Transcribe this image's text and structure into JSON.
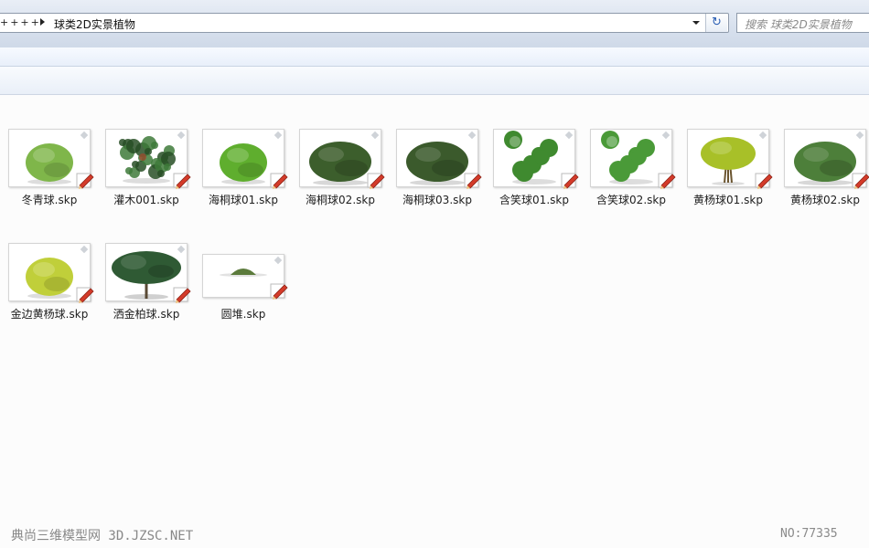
{
  "address": {
    "prev_segment": "++++",
    "current_folder": "球类2D实景植物"
  },
  "search": {
    "placeholder": "搜索 球类2D实景植物"
  },
  "files": [
    {
      "name": "冬青球.skp",
      "plant": "round-shrub",
      "color": "#7fb64a"
    },
    {
      "name": "灌木001.skp",
      "plant": "sparse-shrub",
      "color": "#3e7a3a"
    },
    {
      "name": "海桐球01.skp",
      "plant": "round-shrub",
      "color": "#5fae2e"
    },
    {
      "name": "海桐球02.skp",
      "plant": "wide-shrub",
      "color": "#3c5e2c"
    },
    {
      "name": "海桐球03.skp",
      "plant": "wide-shrub",
      "color": "#3b5a2c"
    },
    {
      "name": "含笑球01.skp",
      "plant": "leafy-shrub",
      "color": "#3f8a2f"
    },
    {
      "name": "含笑球02.skp",
      "plant": "leafy-shrub",
      "color": "#4a9a38"
    },
    {
      "name": "黄杨球01.skp",
      "plant": "small-tree",
      "color": "#a8c028"
    },
    {
      "name": "黄杨球02.skp",
      "plant": "wide-shrub",
      "color": "#4d7f3a"
    },
    {
      "name": "金边黄杨球.skp",
      "plant": "round-shrub",
      "color": "#c0cf3a"
    },
    {
      "name": "洒金柏球.skp",
      "plant": "pine-shrub",
      "color": "#2f5a34"
    },
    {
      "name": "圆堆.skp",
      "plant": "mound",
      "color": "#5c7b3c"
    }
  ],
  "watermark": {
    "left": "典尚三维模型网 3D.JZSC.NET",
    "right": "NO:77335"
  }
}
